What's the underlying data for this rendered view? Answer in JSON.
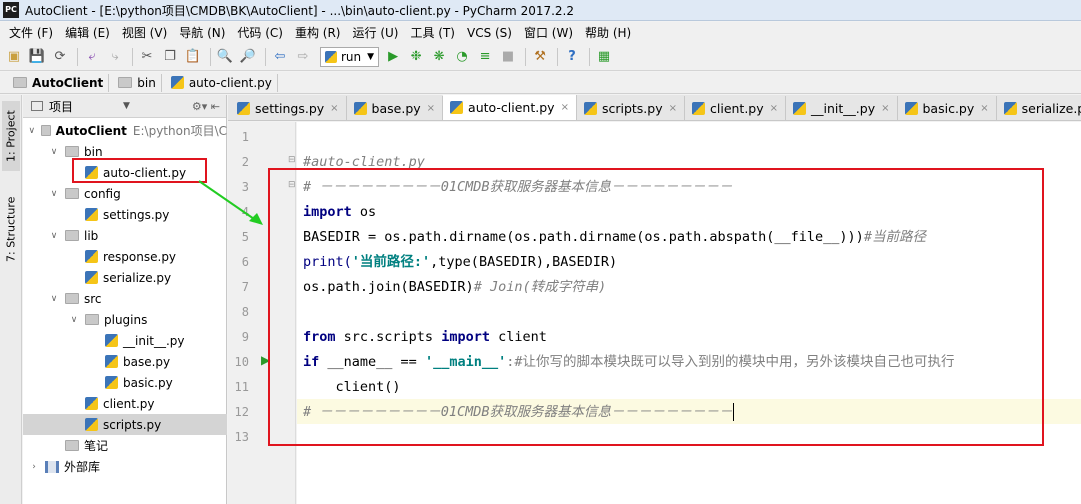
{
  "window": {
    "title": "AutoClient - [E:\\python项目\\CMDB\\BK\\AutoClient] - ...\\bin\\auto-client.py - PyCharm 2017.2.2",
    "app_icon": "PC"
  },
  "menu": [
    "文件 (F)",
    "编辑 (E)",
    "视图 (V)",
    "导航 (N)",
    "代码 (C)",
    "重构 (R)",
    "运行 (U)",
    "工具 (T)",
    "VCS (S)",
    "窗口 (W)",
    "帮助 (H)"
  ],
  "toolbar": {
    "run_config": "run"
  },
  "breadcrumb": [
    "AutoClient",
    "bin",
    "auto-client.py"
  ],
  "side_tabs": {
    "project": "1: Project",
    "structure": "7: Structure"
  },
  "project_panel": {
    "title": "项目",
    "tree": [
      {
        "label": "AutoClient",
        "sub": "E:\\python项目\\C",
        "depth": 0,
        "type": "folder",
        "expanded": true
      },
      {
        "label": "bin",
        "depth": 1,
        "type": "folder",
        "expanded": true
      },
      {
        "label": "auto-client.py",
        "depth": 2,
        "type": "py"
      },
      {
        "label": "config",
        "depth": 1,
        "type": "folder",
        "expanded": true
      },
      {
        "label": "settings.py",
        "depth": 2,
        "type": "py"
      },
      {
        "label": "lib",
        "depth": 1,
        "type": "folder",
        "expanded": true
      },
      {
        "label": "response.py",
        "depth": 2,
        "type": "py"
      },
      {
        "label": "serialize.py",
        "depth": 2,
        "type": "py"
      },
      {
        "label": "src",
        "depth": 1,
        "type": "folder",
        "expanded": true
      },
      {
        "label": "plugins",
        "depth": 2,
        "type": "folder",
        "expanded": true
      },
      {
        "label": "__init__.py",
        "depth": 3,
        "type": "py"
      },
      {
        "label": "base.py",
        "depth": 3,
        "type": "py"
      },
      {
        "label": "basic.py",
        "depth": 3,
        "type": "py"
      },
      {
        "label": "client.py",
        "depth": 2,
        "type": "py"
      },
      {
        "label": "scripts.py",
        "depth": 2,
        "type": "py",
        "selected": true
      },
      {
        "label": "笔记",
        "depth": 1,
        "type": "folder"
      },
      {
        "label": "外部库",
        "depth": 0,
        "type": "lib",
        "collapsed": true
      }
    ]
  },
  "tabs": [
    {
      "label": "settings.py"
    },
    {
      "label": "base.py"
    },
    {
      "label": "auto-client.py",
      "active": true
    },
    {
      "label": "scripts.py"
    },
    {
      "label": "client.py"
    },
    {
      "label": "__init__.py"
    },
    {
      "label": "basic.py"
    },
    {
      "label": "serialize.py"
    }
  ],
  "line_numbers": [
    "1",
    "2",
    "3",
    "4",
    "5",
    "6",
    "7",
    "8",
    "9",
    "10",
    "11",
    "12",
    "13"
  ],
  "code": {
    "l2": "#auto-client.py",
    "l3": "# －－－－－－－－－01CMDB获取服务器基本信息－－－－－－－－－",
    "l4_kw": "import",
    "l4_rest": " os",
    "l5_code": "BASEDIR = os.path.dirname(os.path.dirname(os.path.abspath(__file__)))",
    "l5_cm": "#当前路径",
    "l6_a": "print(",
    "l6_str": "'当前路径:'",
    "l6_b": ",type(BASEDIR),BASEDIR)",
    "l7_code": "os.path.join(BASEDIR)",
    "l7_cm": "# Join(转成字符串)",
    "l9_kw1": "from",
    "l9_mid": " src.scripts ",
    "l9_kw2": "import",
    "l9_end": " client",
    "l10_kw": "if",
    "l10_mid": " __name__ == ",
    "l10_str": "'__main__'",
    "l10_cm": ":#让你写的脚本模块既可以导入到别的模块中用，另外该模块自己也可执行",
    "l11": "    client()",
    "l12": "# －－－－－－－－－01CMDB获取服务器基本信息－－－－－－－－－"
  },
  "annotation_color": "#e0141e",
  "arrow_color": "#22cc22"
}
